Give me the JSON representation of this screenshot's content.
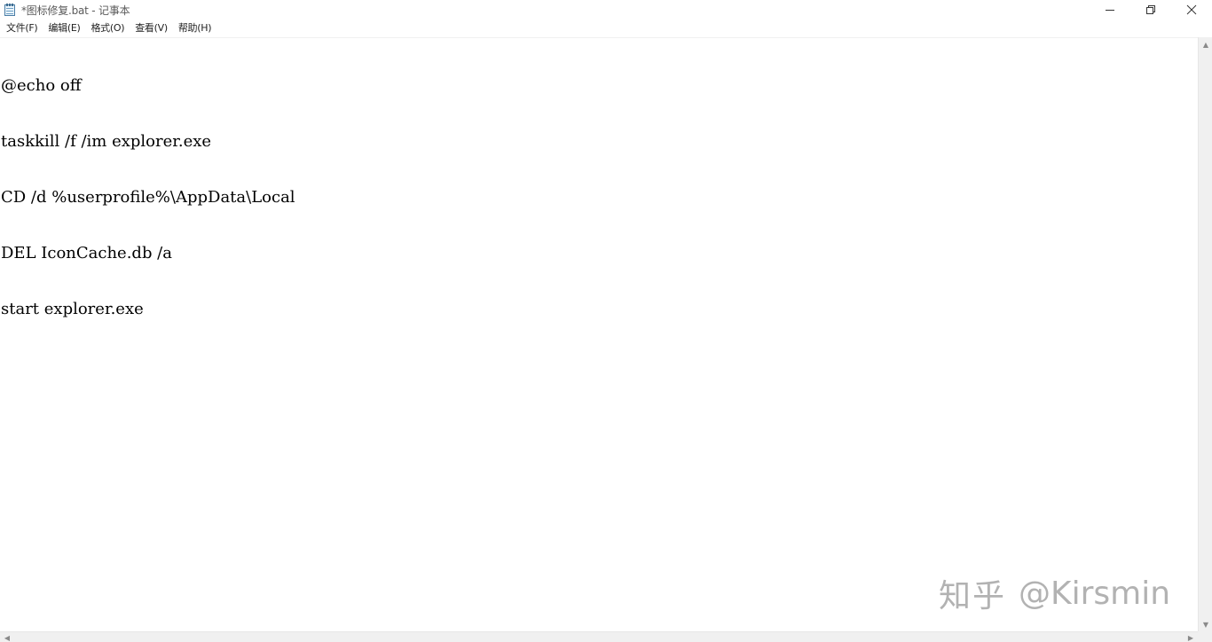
{
  "window": {
    "title": "*图标修复.bat - 记事本",
    "app_icon": "notepad-icon",
    "controls": {
      "minimize_icon": "minimize-icon",
      "maximize_icon": "restore-icon",
      "close_icon": "close-icon"
    }
  },
  "menubar": {
    "items": [
      {
        "label": "文件(F)"
      },
      {
        "label": "编辑(E)"
      },
      {
        "label": "格式(O)"
      },
      {
        "label": "查看(V)"
      },
      {
        "label": "帮助(H)"
      }
    ]
  },
  "editor": {
    "lines": [
      "@echo off",
      "taskkill /f /im explorer.exe",
      "CD /d %userprofile%\\AppData\\Local",
      "DEL IconCache.db /a",
      "start explorer.exe"
    ]
  },
  "watermark": {
    "brand": "知乎",
    "handle": "@Kirsmin"
  },
  "colors": {
    "background": "#ffffff",
    "scrollbar": "#f0f0f0",
    "text": "#000000",
    "watermark": "#aaaaaa"
  }
}
